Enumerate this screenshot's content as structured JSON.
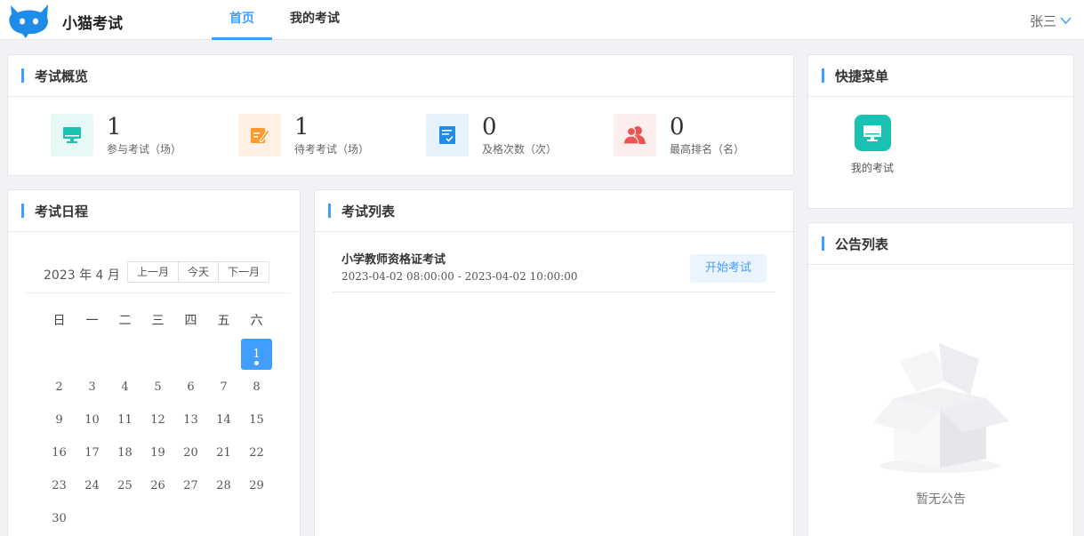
{
  "header": {
    "brand": "小猫考试",
    "tabs": [
      {
        "label": "首页",
        "active": true
      },
      {
        "label": "我的考试",
        "active": false
      }
    ],
    "user": "张三"
  },
  "overview": {
    "title": "考试概览",
    "stats": [
      {
        "value": "1",
        "label": "参与考试（场）",
        "icon": "monitor-icon",
        "color": "#19c2b3",
        "bg": "#e8f8f6"
      },
      {
        "value": "1",
        "label": "待考考试（场）",
        "icon": "edit-icon",
        "color": "#ff9a2e",
        "bg": "#fff1e6"
      },
      {
        "value": "0",
        "label": "及格次数（次）",
        "icon": "checklist-icon",
        "color": "#1e8ce8",
        "bg": "#e6f2fc"
      },
      {
        "value": "0",
        "label": "最高排名（名）",
        "icon": "users-icon",
        "color": "#ef5350",
        "bg": "#fdeeee"
      }
    ]
  },
  "schedule": {
    "title": "考试日程",
    "month_label": "2023 年 4 月",
    "buttons": [
      "上一月",
      "今天",
      "下一月"
    ],
    "weekdays": [
      "日",
      "一",
      "二",
      "三",
      "四",
      "五",
      "六"
    ],
    "days": [
      [
        "",
        "",
        "",
        "",
        "",
        "",
        "1"
      ],
      [
        "2",
        "3",
        "4",
        "5",
        "6",
        "7",
        "8"
      ],
      [
        "9",
        "10",
        "11",
        "12",
        "13",
        "14",
        "15"
      ],
      [
        "16",
        "17",
        "18",
        "19",
        "20",
        "21",
        "22"
      ],
      [
        "23",
        "24",
        "25",
        "26",
        "27",
        "28",
        "29"
      ],
      [
        "30",
        "",
        "",
        "",
        "",
        "",
        ""
      ]
    ],
    "selected_day": "1"
  },
  "exam_list": {
    "title": "考试列表",
    "items": [
      {
        "name": "小学教师资格证考试",
        "time": "2023-04-02 08:00:00 - 2023-04-02 10:00:00",
        "action": "开始考试"
      }
    ]
  },
  "quick_menu": {
    "title": "快捷菜单",
    "items": [
      {
        "label": "我的考试",
        "icon": "monitor-icon"
      }
    ]
  },
  "notices": {
    "title": "公告列表",
    "empty_text": "暂无公告"
  },
  "colors": {
    "accent": "#409eff"
  }
}
